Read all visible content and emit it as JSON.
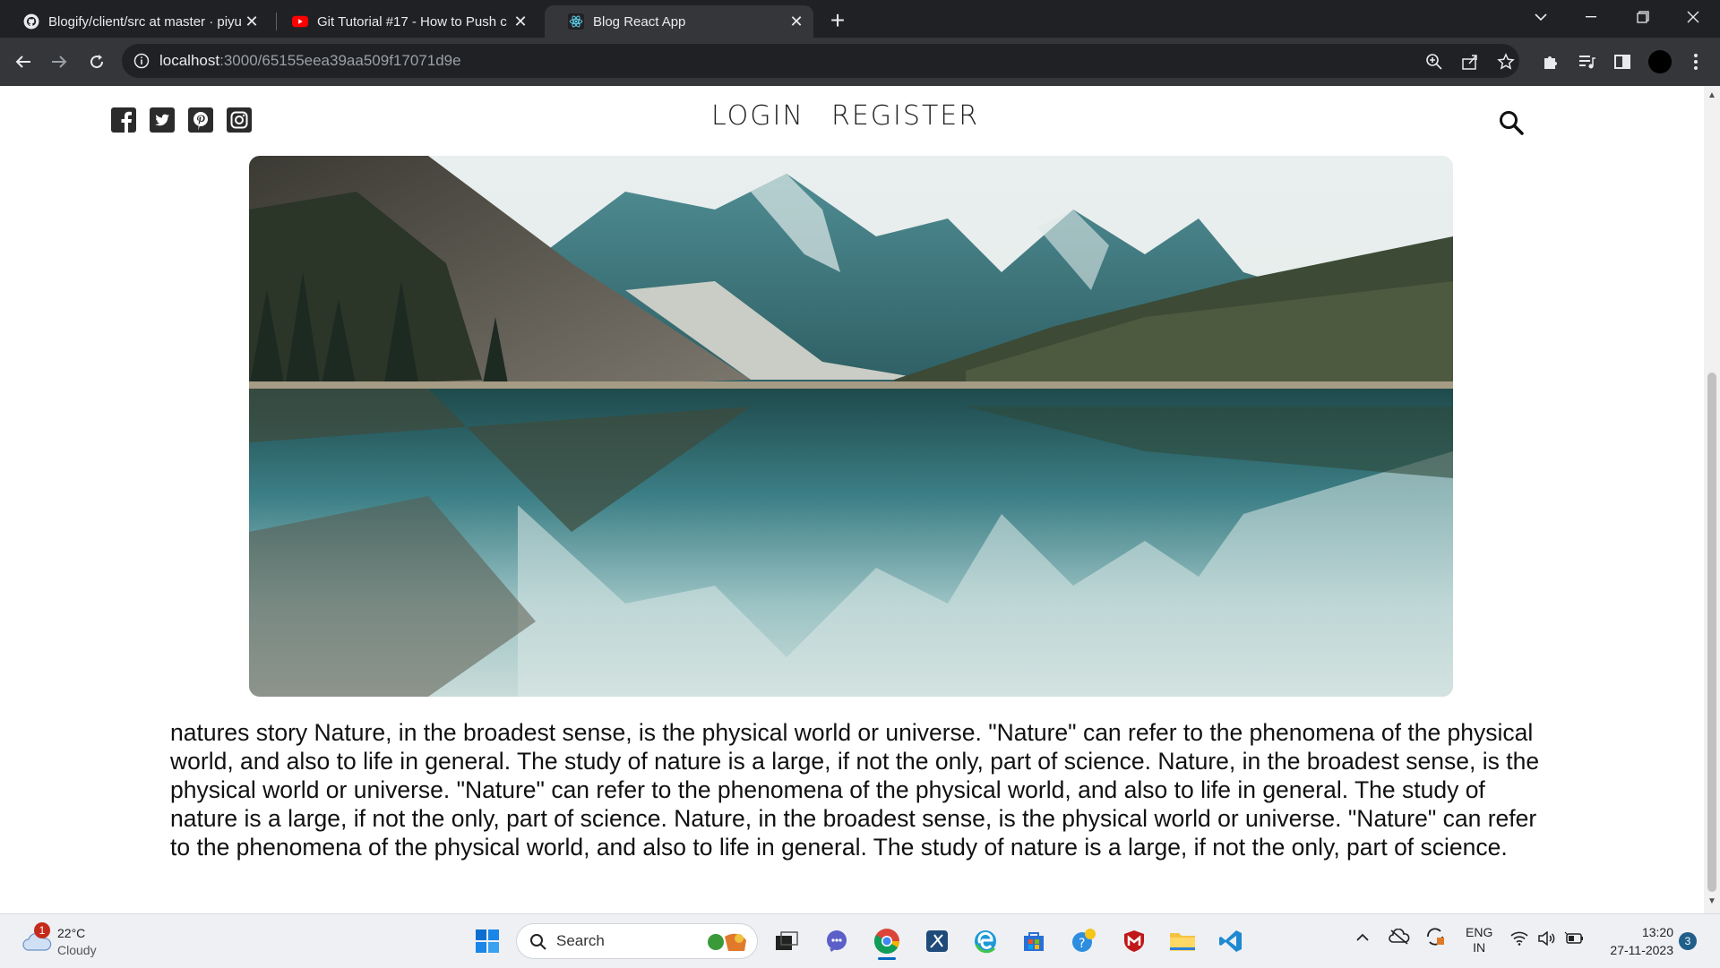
{
  "browser": {
    "tabs": [
      {
        "title": "Blogify/client/src at master · piyu",
        "favicon": "github-icon",
        "active": false
      },
      {
        "title": "Git Tutorial #17 - How to Push c",
        "favicon": "youtube-icon",
        "active": false
      },
      {
        "title": "Blog React App",
        "favicon": "react-icon",
        "active": true
      }
    ],
    "url_host": "localhost",
    "url_path": ":3000/65155eea39aa509f17071d9e"
  },
  "site": {
    "nav": {
      "login": "LOGIN",
      "register": "REGISTER"
    },
    "social_icons": [
      "facebook-icon",
      "twitter-icon",
      "pinterest-icon",
      "instagram-icon"
    ],
    "post": {
      "body": "natures story Nature, in the broadest sense, is the physical world or universe. \"Nature\" can refer to the phenomena of the physical world, and also to life in general. The study of nature is a large, if not the only, part of science. Nature, in the broadest sense, is the physical world or universe. \"Nature\" can refer to the phenomena of the physical world, and also to life in general. The study of nature is a large, if not the only, part of science. Nature, in the broadest sense, is the physical world or universe. \"Nature\" can refer to the phenomena of the physical world, and also to life in general. The study of nature is a large, if not the only, part of science."
    }
  },
  "taskbar": {
    "weather_temp": "22°C",
    "weather_desc": "Cloudy",
    "weather_badge": "1",
    "search_label": "Search",
    "lang_line1": "ENG",
    "lang_line2": "IN",
    "time": "13:20",
    "date": "27-11-2023",
    "notification_count": "3"
  },
  "colors": {
    "tab_bar": "#202124",
    "toolbar": "#35363a",
    "taskbar": "#eef0f4"
  }
}
